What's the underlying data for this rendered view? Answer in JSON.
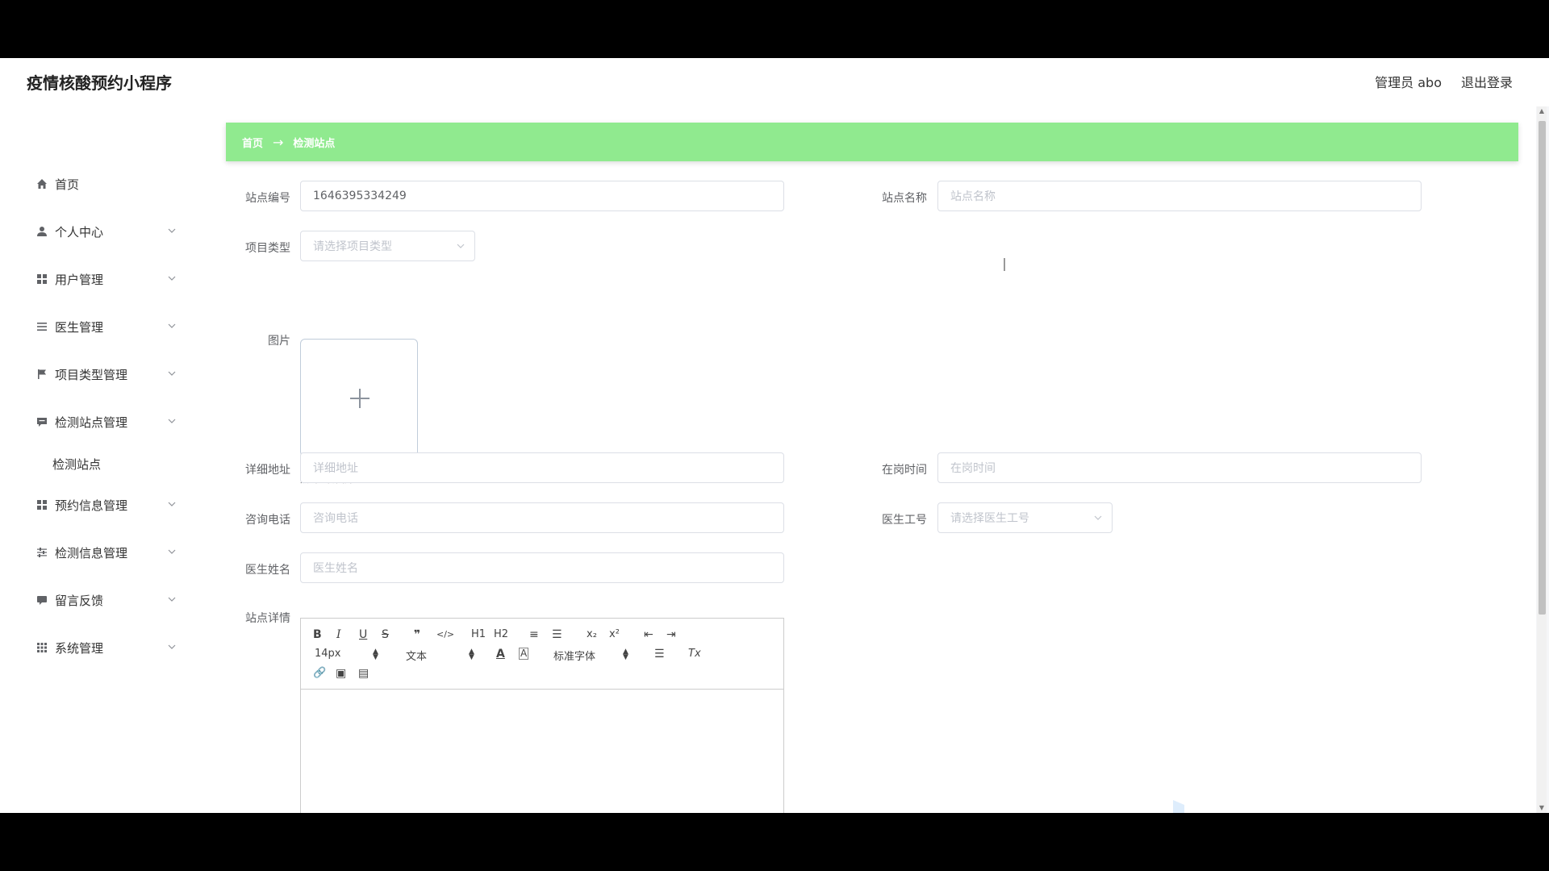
{
  "header": {
    "app_title": "疫情核酸预约小程序",
    "user_label": "管理员 abo",
    "logout_label": "退出登录"
  },
  "sidebar": {
    "items": [
      {
        "label": "首页",
        "icon": "home-icon",
        "has_arrow": false
      },
      {
        "label": "个人中心",
        "icon": "user-icon",
        "has_arrow": true
      },
      {
        "label": "用户管理",
        "icon": "grid-icon",
        "has_arrow": true
      },
      {
        "label": "医生管理",
        "icon": "list-icon",
        "has_arrow": true
      },
      {
        "label": "项目类型管理",
        "icon": "flag-icon",
        "has_arrow": true
      },
      {
        "label": "检测站点管理",
        "icon": "message-icon",
        "has_arrow": true
      },
      {
        "label": "预约信息管理",
        "icon": "grid-icon",
        "has_arrow": true
      },
      {
        "label": "检测信息管理",
        "icon": "sliders-icon",
        "has_arrow": true
      },
      {
        "label": "留言反馈",
        "icon": "chat-icon",
        "has_arrow": true
      },
      {
        "label": "系统管理",
        "icon": "apps-icon",
        "has_arrow": true
      }
    ],
    "subitem": "检测站点"
  },
  "breadcrumb": {
    "home": "首页",
    "separator": "→",
    "current": "检测站点"
  },
  "form": {
    "station_no": {
      "label": "站点编号",
      "value": "1646395334249"
    },
    "station_name": {
      "label": "站点名称",
      "placeholder": "站点名称"
    },
    "project_type": {
      "label": "项目类型",
      "placeholder": "请选择项目类型"
    },
    "image": {
      "label": "图片",
      "tip": "点击上传图片"
    },
    "address": {
      "label": "详细地址",
      "placeholder": "详细地址"
    },
    "on_duty": {
      "label": "在岗时间",
      "placeholder": "在岗时间"
    },
    "phone": {
      "label": "咨询电话",
      "placeholder": "咨询电话"
    },
    "doctor_no": {
      "label": "医生工号",
      "placeholder": "请选择医生工号"
    },
    "doctor_name": {
      "label": "医生姓名",
      "placeholder": "医生姓名"
    },
    "details": {
      "label": "站点详情"
    }
  },
  "editor": {
    "buttons": {
      "bold": "B",
      "italic": "I",
      "underline": "U",
      "strike": "S",
      "quote": "❞",
      "code": "</>",
      "h1": "H1",
      "h2": "H2",
      "ordered": "≡",
      "bullet": "☰",
      "sub": "x₂",
      "sup": "x²",
      "outdent": "⇤",
      "indent": "⇥",
      "color": "A",
      "background": "A",
      "align": "☰",
      "clean": "Tx",
      "link": "🔗",
      "image": "▣",
      "video": "▤"
    },
    "size": "14px",
    "header": "文本",
    "font": "标准字体"
  },
  "colors": {
    "breadcrumb_bg": "#90ea8f",
    "accent": "#90ea8f"
  }
}
